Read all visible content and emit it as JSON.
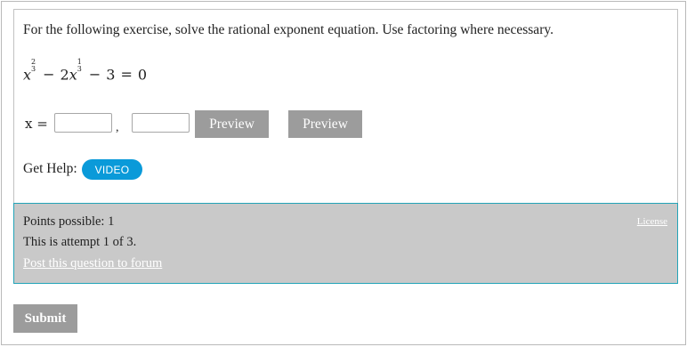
{
  "question": {
    "prompt": "For the following exercise, solve the rational exponent equation. Use factoring where necessary.",
    "equation": {
      "term1_base": "x",
      "term1_exp_num": "2",
      "term1_exp_den": "3",
      "op1": "−",
      "term2_coef": "2",
      "term2_base": "x",
      "term2_exp_num": "1",
      "term2_exp_den": "3",
      "op2": "−",
      "constant": "3",
      "equals": "=",
      "rhs": "0"
    },
    "answer": {
      "label": "x =",
      "separator": ",",
      "input1_value": "",
      "input2_value": ""
    },
    "preview1_label": "Preview",
    "preview2_label": "Preview",
    "help_label": "Get Help:",
    "video_label": "VIDEO"
  },
  "info": {
    "points": "Points possible: 1",
    "attempt": "This is attempt 1 of 3.",
    "forum_link": "Post this question to forum",
    "license_link": "License"
  },
  "submit_label": "Submit",
  "colors": {
    "button_gray": "#9c9c9c",
    "video_blue": "#0a9ad9",
    "info_bg": "#c9c9c9",
    "info_border": "#23a4b8"
  }
}
